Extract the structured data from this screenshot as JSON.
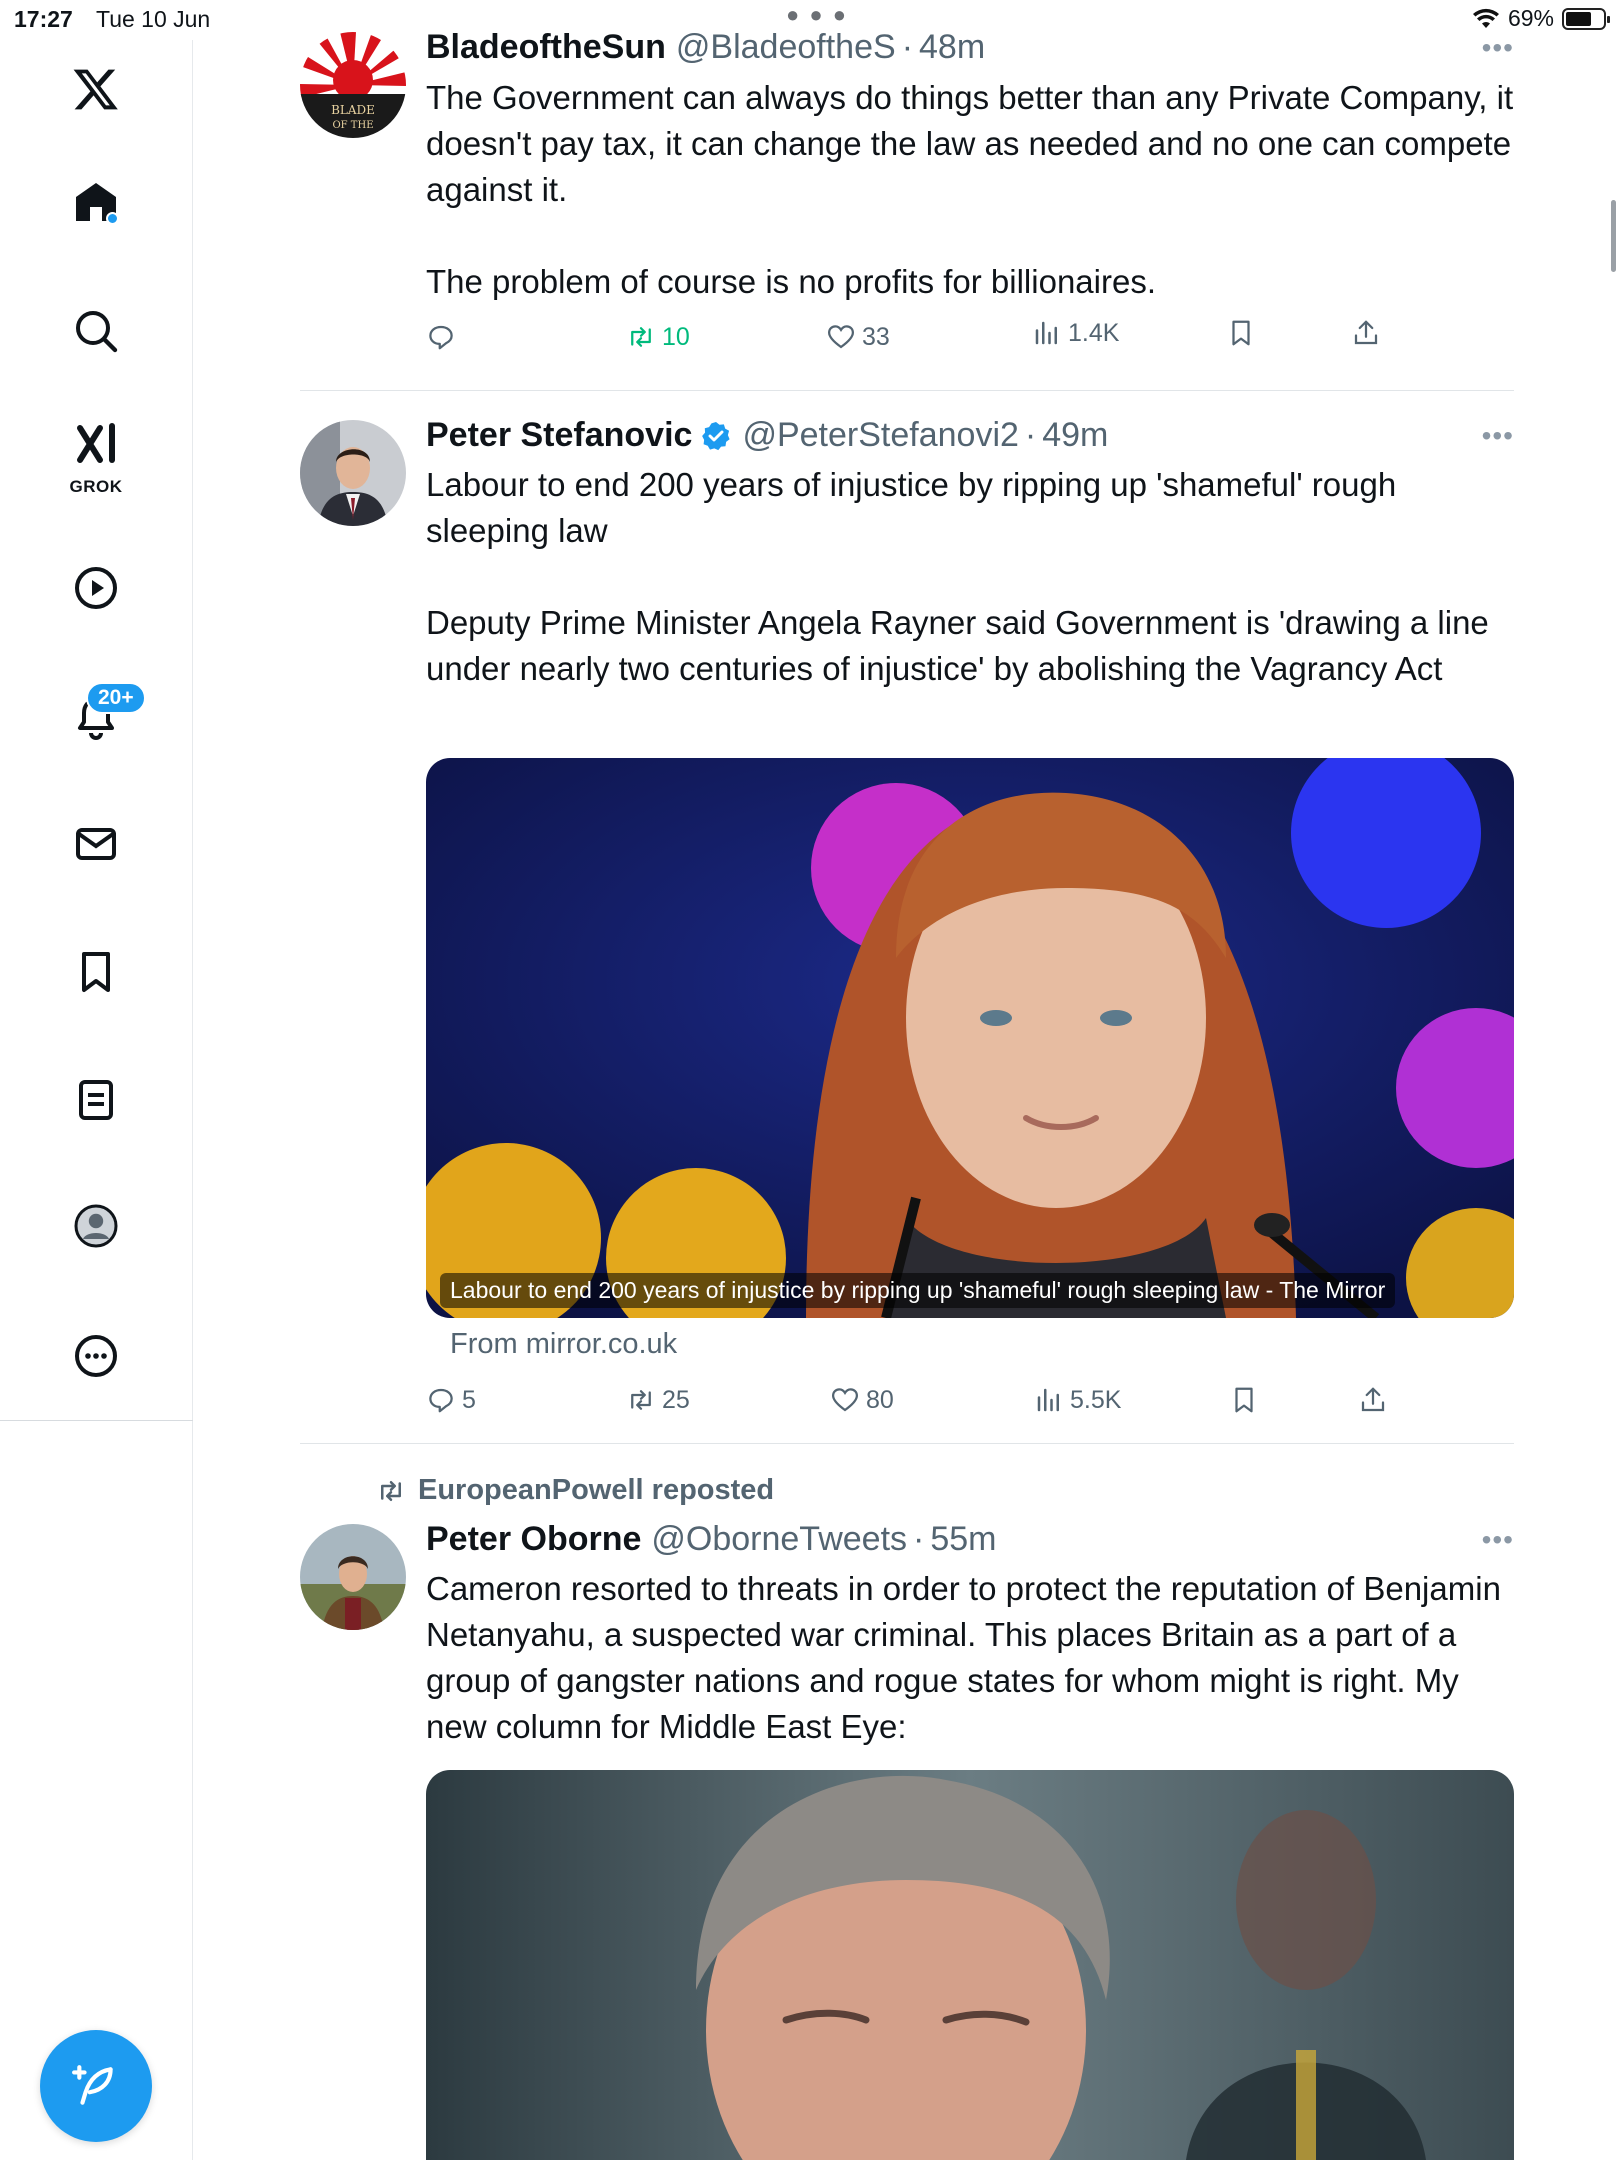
{
  "status_bar": {
    "time": "17:27",
    "date": "Tue 10 Jun",
    "battery": "69%",
    "battery_level": 0.69
  },
  "sidebar": {
    "icons": [
      "x-logo-icon",
      "home-icon",
      "search-icon",
      "grok-icon",
      "video-icon",
      "bell-icon",
      "mail-icon",
      "bookmark-icon",
      "lists-icon",
      "profile-icon",
      "more-icon"
    ],
    "grok_label": "GROK",
    "notifications_badge": "20+",
    "accent": "#1d9bf0"
  },
  "tweets": [
    {
      "name": "BladeoftheSun",
      "handle": "@BladeoftheS",
      "time": "48m",
      "avatar_text": "BLADE OF THE",
      "text": [
        "The Government can always do things better than any Private Company, it doesn't pay tax, it can change the law as needed and no one can compete against it.",
        "The problem of course is no profits for billionaires."
      ],
      "replies": "",
      "reposts": "10",
      "likes": "33",
      "views": "1.4K"
    },
    {
      "name": "Peter Stefanovic",
      "verified": true,
      "handle": "@PeterStefanovi2",
      "time": "49m",
      "text": [
        "Labour to end 200 years of injustice by ripping up 'shameful' rough sleeping law",
        "Deputy Prime Minister Angela Rayner said Government is 'drawing a line under nearly two centuries of injustice' by abolishing the Vagrancy Act"
      ],
      "media_caption": "Labour to end 200 years of injustice by ripping up 'shameful' rough sleeping law - The Mirror",
      "source": "From mirror.co.uk",
      "replies": "5",
      "reposts": "25",
      "likes": "80",
      "views": "5.5K"
    },
    {
      "reposted_by": "EuropeanPowell reposted",
      "name": "Peter Oborne",
      "handle": "@OborneTweets",
      "time": "55m",
      "text": [
        "Cameron resorted to threats in order to protect the reputation of Benjamin Netanyahu, a suspected war criminal. This  places Britain as a part of a group of gangster nations and rogue states for whom might is right. My new column for Middle East Eye:"
      ]
    }
  ],
  "separator": "·",
  "more_glyph": "•••"
}
